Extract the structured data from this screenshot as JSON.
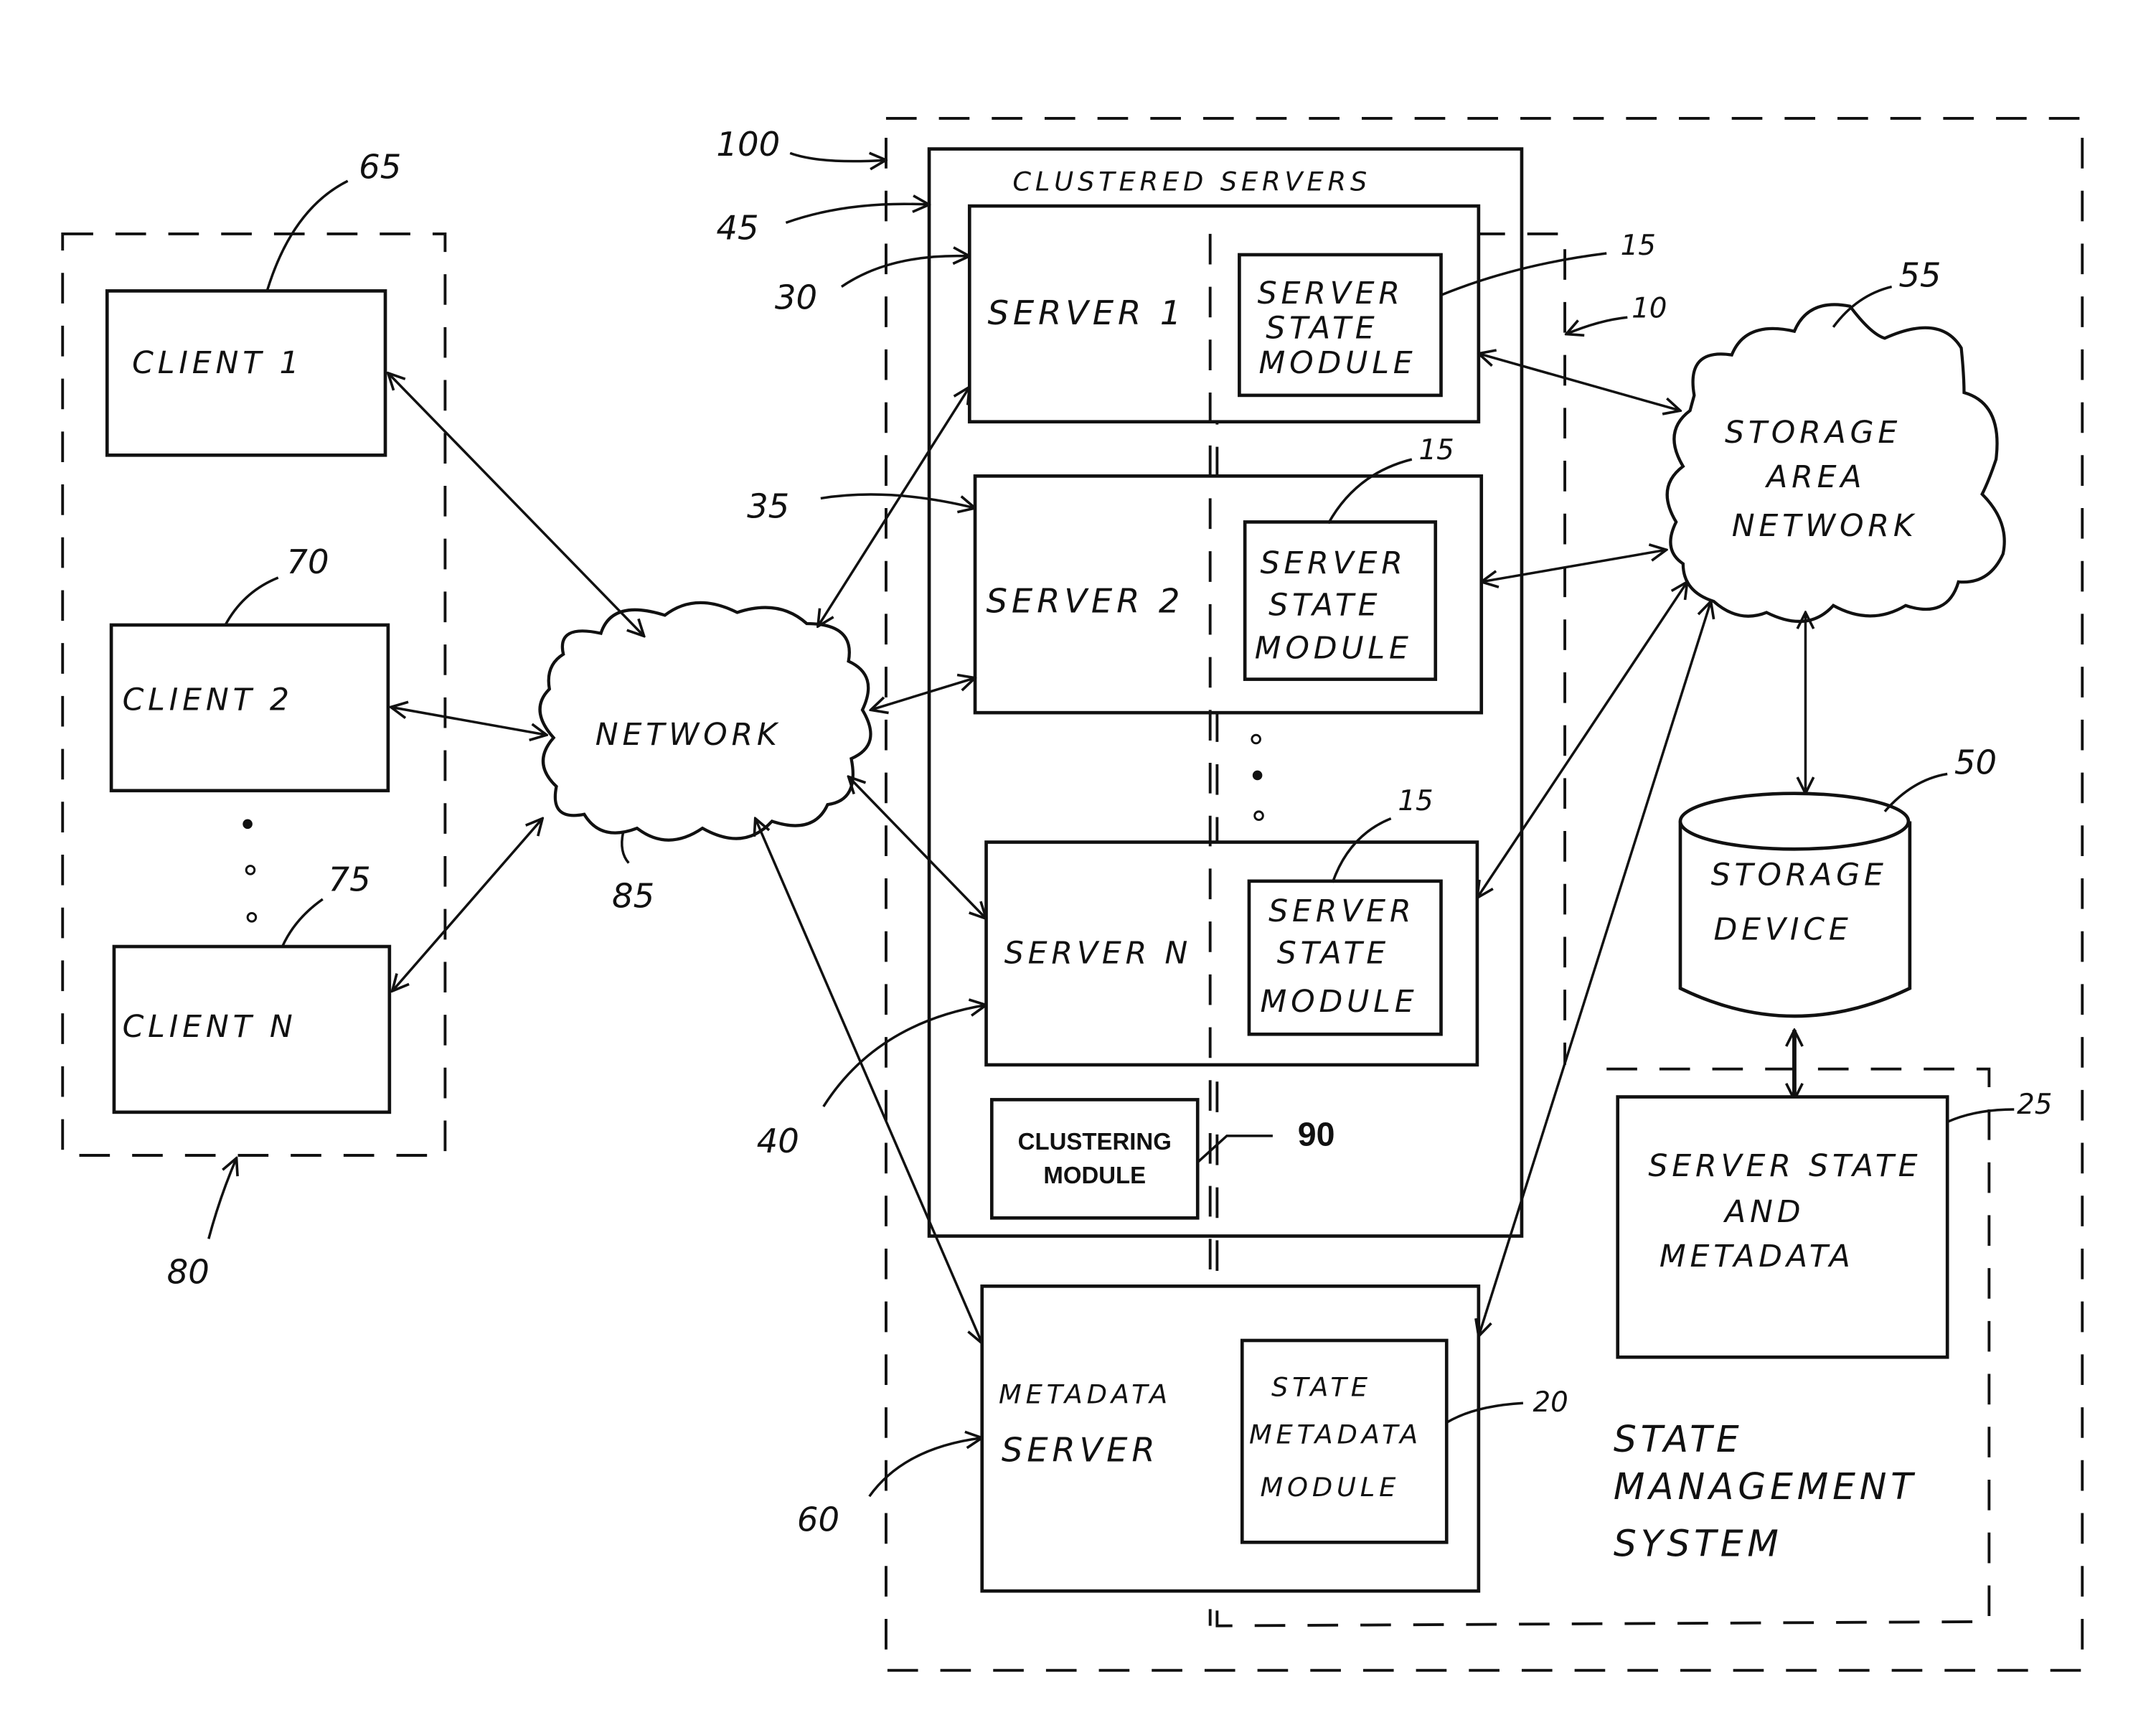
{
  "figure": {
    "system_label": "State Management System",
    "colors": {
      "ink": "#111111",
      "paper": "#ffffff"
    }
  },
  "clients": {
    "group_ref": "80",
    "items": [
      {
        "label": "CLIENT  1",
        "ref": "65"
      },
      {
        "label": "CLIENT  2",
        "ref": "70"
      },
      {
        "label": "CLIENT  N",
        "ref": "75"
      }
    ],
    "ellipsis": "•\n•\n•"
  },
  "network": {
    "label": "NETWORK",
    "ref": "85"
  },
  "clustered_servers": {
    "title": "CLUSTERED  SERVERS",
    "ref": "45",
    "system_ref": "100",
    "servers": [
      {
        "label": "SERVER 1",
        "ref": "30",
        "module_lines": [
          "SERVER",
          "STATE",
          "MODULE"
        ],
        "module_ref": "15"
      },
      {
        "label": "SERVER  2",
        "ref": "35",
        "module_lines": [
          "SERVER",
          "STATE",
          "MODULE"
        ],
        "module_ref": "15"
      },
      {
        "label": "SERVER  N",
        "ref": "40",
        "module_lines": [
          "SERVER",
          "STATE",
          "MODULE"
        ],
        "module_ref": "15"
      }
    ],
    "clustering_module": {
      "lines": [
        "CLUSTERING",
        "MODULE"
      ],
      "ref": "90"
    }
  },
  "state_boundary_ref": "10",
  "metadata_server": {
    "lines": [
      "METADATA",
      "SERVER"
    ],
    "ref": "60",
    "module_lines": [
      "STATE",
      "METADATA",
      "MODULE"
    ],
    "module_ref": "20"
  },
  "san": {
    "lines": [
      "STORAGE",
      "AREA",
      "NETWORK"
    ],
    "ref": "55"
  },
  "storage_device": {
    "lines": [
      "STORAGE",
      "DEVICE"
    ],
    "ref": "50"
  },
  "state_store": {
    "lines": [
      "SERVER  STATE",
      "AND",
      "METADATA"
    ],
    "ref": "25"
  },
  "state_management_label": [
    "STATE",
    "MANAGEMENT",
    "SYSTEM"
  ]
}
